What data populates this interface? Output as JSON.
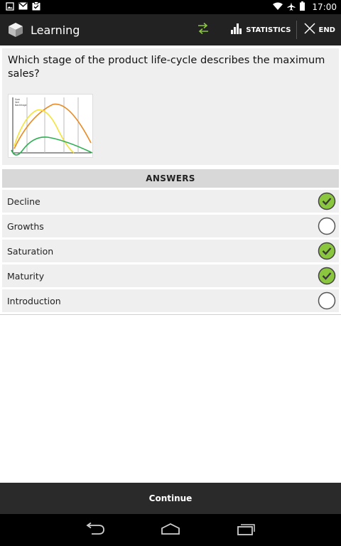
{
  "status_bar": {
    "time": "17:00",
    "left_icons": [
      "image-icon",
      "mail-icon",
      "task-icon"
    ],
    "right_icons": [
      "wifi-icon",
      "airplane-icon",
      "battery-icon"
    ]
  },
  "action_bar": {
    "title": "Learning",
    "statistics_label": "STATISTICS",
    "end_label": "END",
    "accent_color": "#8bc63f"
  },
  "question": {
    "text": "Which stage of the product life-cycle describes the maximum sales?",
    "image_alt": "product-life-cycle-chart",
    "image_legend_lines": [
      "Sum",
      "Verl",
      "Nachfrage"
    ]
  },
  "answers": {
    "header": "ANSWERS",
    "items": [
      {
        "label": "Decline",
        "checked": true
      },
      {
        "label": "Growths",
        "checked": false
      },
      {
        "label": "Saturation",
        "checked": true
      },
      {
        "label": "Maturity",
        "checked": true
      },
      {
        "label": "Introduction",
        "checked": false
      }
    ]
  },
  "continue_label": "Continue",
  "nav_bar": {
    "icons": [
      "back-icon",
      "home-icon",
      "recents-icon"
    ]
  }
}
